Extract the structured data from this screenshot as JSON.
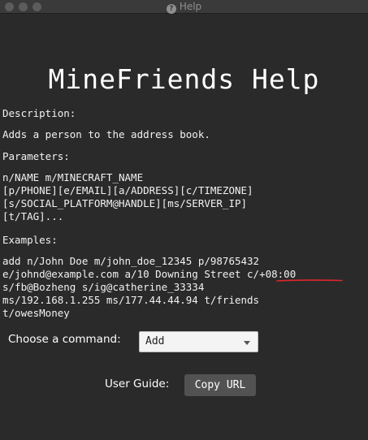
{
  "window": {
    "title": "Help"
  },
  "heading": "MineFriends Help",
  "description": {
    "label": "Description:",
    "text": "Adds a person to the address book."
  },
  "parameters": {
    "label": "Parameters:",
    "lines": [
      "n/NAME m/MINECRAFT_NAME",
      "[p/PHONE][e/EMAIL][a/ADDRESS][c/TIMEZONE]",
      "[s/SOCIAL_PLATFORM@HANDLE][ms/SERVER_IP]",
      "[t/TAG]..."
    ]
  },
  "examples": {
    "label": "Examples:",
    "lines": [
      "add n/John Doe m/john_doe_12345 p/98765432",
      "e/johnd@example.com a/10 Downing Street ",
      "s/fb@Bozheng s/ig@catherine_33334",
      "ms/192.168.1.255 ms/177.44.44.94 t/friends",
      "t/owesMoney"
    ],
    "timezone_text": "c/+08:00"
  },
  "command": {
    "label": "Choose a command:",
    "selected": "Add"
  },
  "guide": {
    "label": "User Guide:",
    "button": "Copy URL"
  },
  "colors": {
    "background": "#2a2a2a",
    "annotation": "#e0262b"
  }
}
